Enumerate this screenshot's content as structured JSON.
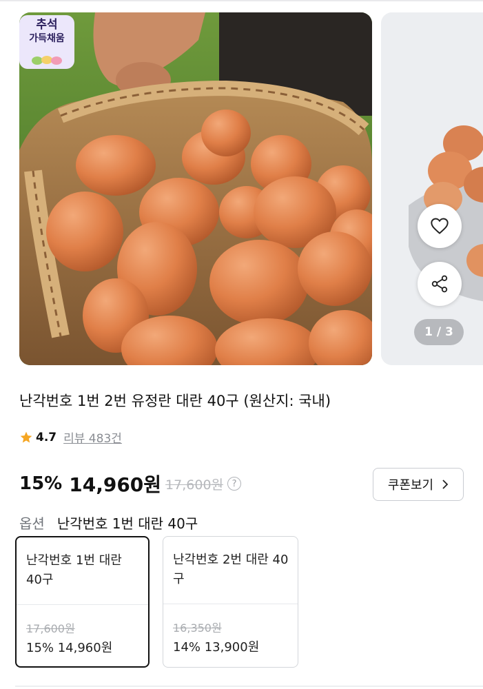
{
  "carousel": {
    "badge_line1": "추석",
    "badge_line2": "가득채움",
    "pager": "1 / 3",
    "icons": {
      "wishlist": "heart-icon",
      "share": "share-icon"
    }
  },
  "product": {
    "title": "난각번호 1번 2번 유정란 대란 40구 (원산지: 국내)",
    "rating": "4.7",
    "reviews": "리뷰 483건",
    "discount_rate": "15%",
    "sale_price": "14,960원",
    "original_price": "17,600원",
    "help_glyph": "?",
    "coupon_label": "쿠폰보기",
    "coupon_chevron": "›"
  },
  "option": {
    "label": "옵션",
    "selected_value": "난각번호 1번 대란 40구",
    "cards": [
      {
        "name": "난각번호 1번 대란 40구",
        "original": "17,600원",
        "sale": "15% 14,960원",
        "selected": true
      },
      {
        "name": "난각번호 2번 대란 40구",
        "original": "16,350원",
        "sale": "14% 13,900원",
        "selected": false
      }
    ]
  },
  "colors": {
    "star": "#f5a623",
    "text": "#111111",
    "muted": "#8a8d93",
    "strike": "#b6b8bc"
  }
}
